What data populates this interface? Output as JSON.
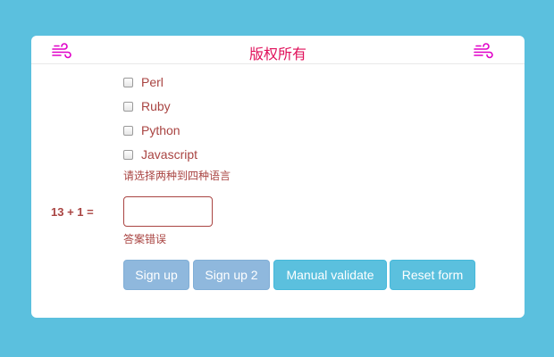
{
  "header": {
    "title": "版权所有",
    "left_icon": "wind-icon",
    "right_icon": "wind-icon",
    "accent_color": "#e0105a",
    "icon_color": "#e000c8"
  },
  "languages": {
    "options": [
      "Perl",
      "Ruby",
      "Python",
      "Javascript"
    ],
    "checked": [
      false,
      false,
      false,
      false
    ],
    "error": "请选择两种到四种语言"
  },
  "captcha": {
    "label": "13 + 1 =",
    "value": "",
    "error": "答案错误"
  },
  "buttons": {
    "sign_up": "Sign up",
    "sign_up_2": "Sign up 2",
    "manual_validate": "Manual validate",
    "reset_form": "Reset form"
  },
  "colors": {
    "background": "#5bc0de",
    "error": "#a94442",
    "primary_disabled": "#8fb8dd",
    "info": "#5bc0de"
  }
}
